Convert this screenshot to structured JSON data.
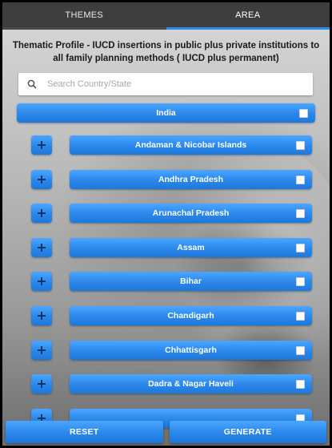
{
  "tabs": [
    {
      "label": "THEMES",
      "active": false
    },
    {
      "label": "AREA",
      "active": true
    }
  ],
  "title": "Thematic Profile - IUCD insertions in public plus private institutions to all family planning methods ( IUCD plus permanent)",
  "search": {
    "placeholder": "Search Country/State",
    "value": "",
    "icon": "search-icon"
  },
  "country": {
    "label": "India",
    "checked": false
  },
  "states": [
    {
      "label": "Andaman & Nicobar Islands",
      "checked": false
    },
    {
      "label": "Andhra Pradesh",
      "checked": false
    },
    {
      "label": "Arunachal Pradesh",
      "checked": false
    },
    {
      "label": "Assam",
      "checked": false
    },
    {
      "label": "Bihar",
      "checked": false
    },
    {
      "label": "Chandigarh",
      "checked": false
    },
    {
      "label": "Chhattisgarh",
      "checked": false
    },
    {
      "label": "Dadra & Nagar Haveli",
      "checked": false
    },
    {
      "label": "",
      "checked": false
    }
  ],
  "actions": {
    "reset_label": "RESET",
    "generate_label": "GENERATE"
  },
  "colors": {
    "accent": "#2a87ea",
    "tab_bar": "#3e3e3e",
    "active_tab_underline": "#2e8ae6"
  }
}
